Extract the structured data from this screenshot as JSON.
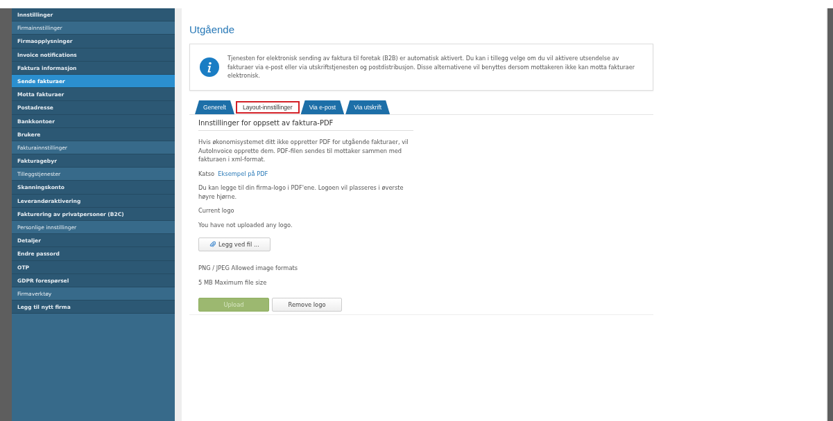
{
  "sidebar": {
    "items": [
      {
        "label": "Innstillinger",
        "kind": "item",
        "selected": false
      },
      {
        "label": "Firmainnstillinger",
        "kind": "section",
        "selected": false
      },
      {
        "label": "Firmaopplysninger",
        "kind": "item",
        "selected": false
      },
      {
        "label": "Invoice notifications",
        "kind": "item",
        "selected": false
      },
      {
        "label": "Faktura informasjon",
        "kind": "item",
        "selected": false
      },
      {
        "label": "Sende fakturaer",
        "kind": "item",
        "selected": true
      },
      {
        "label": "Motta fakturaer",
        "kind": "item",
        "selected": false
      },
      {
        "label": "Postadresse",
        "kind": "item",
        "selected": false
      },
      {
        "label": "Bankkontoer",
        "kind": "item",
        "selected": false
      },
      {
        "label": "Brukere",
        "kind": "item",
        "selected": false
      },
      {
        "label": "Fakturainnstillinger",
        "kind": "section",
        "selected": false
      },
      {
        "label": "Fakturagebyr",
        "kind": "item",
        "selected": false
      },
      {
        "label": "Tilleggstjenester",
        "kind": "section",
        "selected": false
      },
      {
        "label": "Skanningskonto",
        "kind": "item",
        "selected": false
      },
      {
        "label": "Leverandøraktivering",
        "kind": "item",
        "selected": false
      },
      {
        "label": "Fakturering av privatpersoner (B2C)",
        "kind": "item",
        "selected": false
      },
      {
        "label": "Personlige innstillinger",
        "kind": "section",
        "selected": false
      },
      {
        "label": "Detaljer",
        "kind": "item",
        "selected": false
      },
      {
        "label": "Endre passord",
        "kind": "item",
        "selected": false
      },
      {
        "label": "OTP",
        "kind": "item",
        "selected": false
      },
      {
        "label": "GDPR forespørsel",
        "kind": "item",
        "selected": false
      },
      {
        "label": "Firmaverktøy",
        "kind": "section",
        "selected": false
      },
      {
        "label": "Legg til nytt firma",
        "kind": "item",
        "selected": false
      }
    ]
  },
  "page_title": "Utgående",
  "info": "Tjenesten for elektronisk sending av faktura til foretak (B2B) er automatisk aktivert. Du kan i tillegg velge om du vil aktivere utsendelse av fakturaer via e-post eller via utskriftstjenesten og postdistribusjon. Disse alternativene vil benyttes dersom mottakeren ikke kan motta fakturaer elektronisk.",
  "tabs": [
    {
      "label": "Generelt",
      "selected": false
    },
    {
      "label": "Layout-innstillinger",
      "selected": true
    },
    {
      "label": "Via e-post",
      "selected": false
    },
    {
      "label": "Via utskrift",
      "selected": false
    }
  ],
  "section_title": "Innstillinger for oppsett av faktura-PDF",
  "description": "Hvis økonomisystemet ditt ikke oppretter PDF for utgående fakturaer, vil AutoInvoice opprette dem. PDF-filen sendes til mottaker sammen med fakturaen i xml-format.",
  "see_label": "Katso",
  "see_link": "Eksempel på PDF",
  "logo_text": "Du kan legge til din firma-logo i PDF'ene. Logoen vil plasseres i øverste høyre hjørne.",
  "current_logo_label": "Current logo",
  "current_logo_value": "You have not uploaded any logo.",
  "attach_button": "Legg ved fil ...",
  "formats": "PNG / JPEG Allowed image formats",
  "max_size": "5 MB Maximum file size",
  "upload_button": {
    "label": "Upload",
    "disabled": true
  },
  "remove_button": "Remove logo"
}
